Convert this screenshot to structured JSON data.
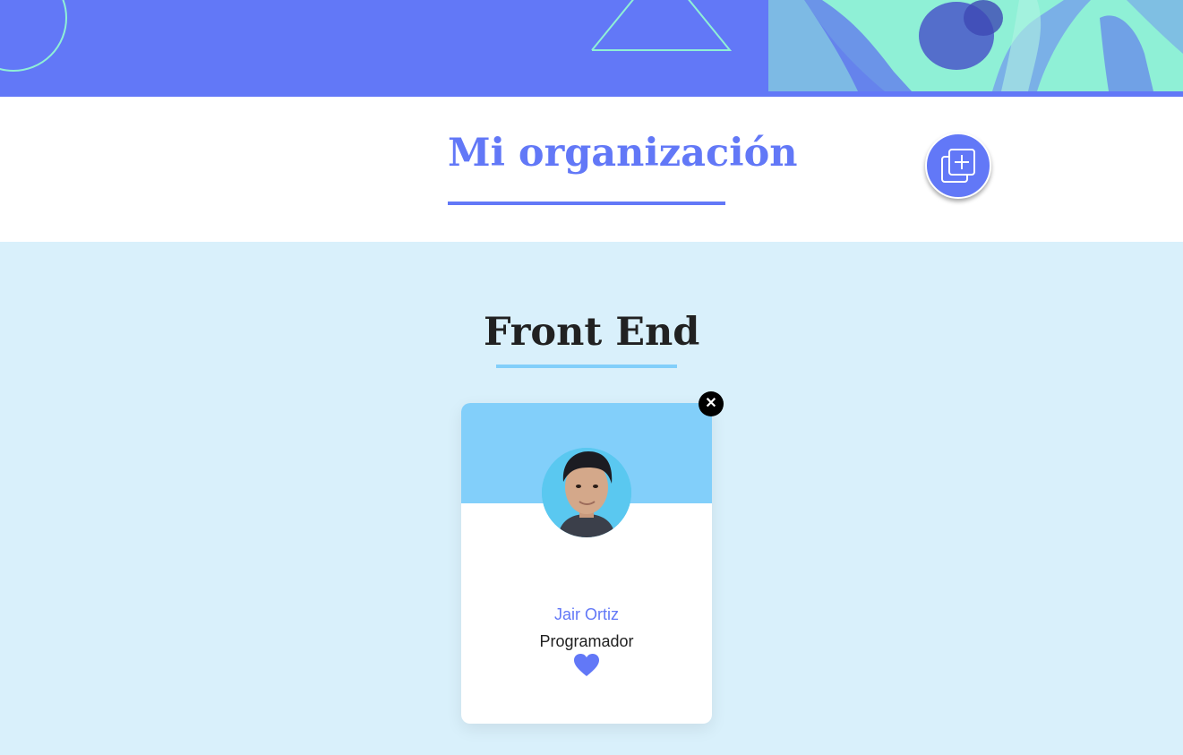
{
  "header": {
    "accent_color": "#6278f7",
    "decor_color": "#8ff0d6",
    "banner_image": "people-collaborating-photo"
  },
  "organization": {
    "title": "Mi organización",
    "add_icon": "add-collection-icon"
  },
  "team": {
    "title": "Front End",
    "background_color": "#d9f0fb",
    "primary_color": "#82cffa",
    "members": [
      {
        "name": "Jair Ortiz",
        "role": "Programador",
        "favorite": true,
        "close_label": "✕",
        "avatar_icon": "avatar-photo"
      }
    ]
  }
}
